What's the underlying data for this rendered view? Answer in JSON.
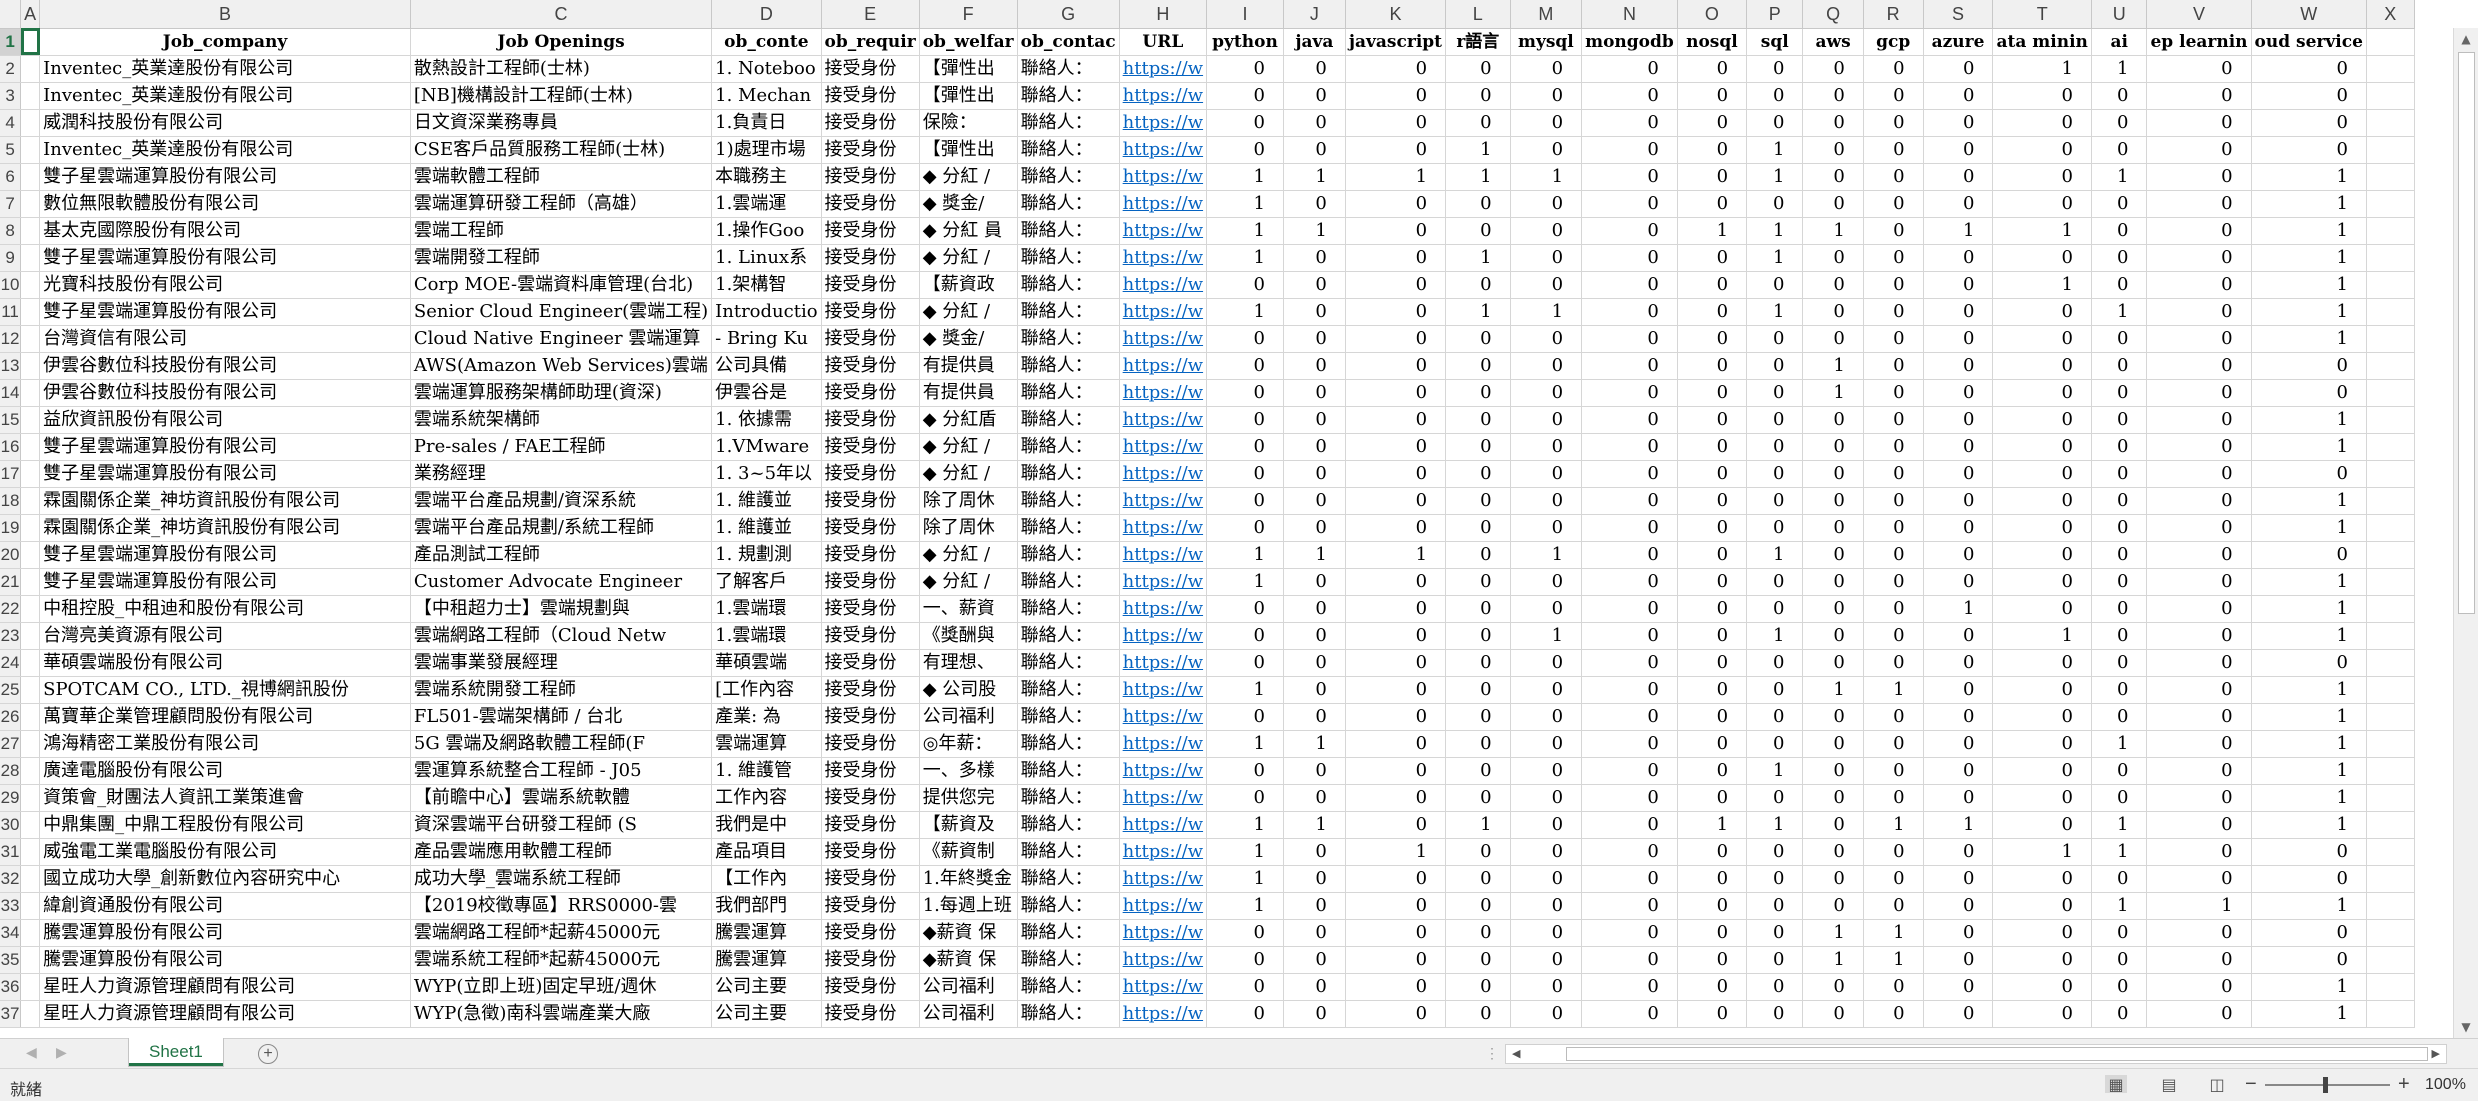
{
  "columns": [
    "A",
    "B",
    "C",
    "D",
    "E",
    "F",
    "G",
    "H",
    "I",
    "J",
    "K",
    "L",
    "M",
    "N",
    "O",
    "P",
    "Q",
    "R",
    "S",
    "T",
    "U",
    "V",
    "W",
    "X"
  ],
  "header_row": [
    "",
    "Job_company",
    "Job Openings",
    "ob_conte",
    "ob_requir",
    "ob_welfar",
    "ob_contac",
    "URL",
    "python",
    "java",
    "javascript",
    "r語言",
    "mysql",
    "mongodb",
    "nosql",
    "sql",
    "aws",
    "gcp",
    "azure",
    "ata minin",
    "ai",
    "ep learnin",
    "oud service",
    ""
  ],
  "rows": [
    {
      "n": 2,
      "company": "Inventec_英業達股份有限公司",
      "job": "散熱設計工程師(士林)",
      "content": "1. Noteboo",
      "req": "接受身份",
      "welf": "【彈性出",
      "contact": "聯絡人：",
      "url": "https://w",
      "v": [
        0,
        0,
        0,
        0,
        0,
        0,
        0,
        0,
        0,
        0,
        0,
        1,
        1,
        0,
        0
      ]
    },
    {
      "n": 3,
      "company": "Inventec_英業達股份有限公司",
      "job": "[NB]機構設計工程師(士林)",
      "content": "1. Mechan",
      "req": "接受身份",
      "welf": "【彈性出",
      "contact": "聯絡人：",
      "url": "https://w",
      "v": [
        0,
        0,
        0,
        0,
        0,
        0,
        0,
        0,
        0,
        0,
        0,
        0,
        0,
        0,
        0
      ]
    },
    {
      "n": 4,
      "company": "威潤科技股份有限公司",
      "job": "日文資深業務專員",
      "content": "1.負責日",
      "req": "接受身份",
      "welf": "保險：",
      "contact": "聯絡人：",
      "url": "https://w",
      "v": [
        0,
        0,
        0,
        0,
        0,
        0,
        0,
        0,
        0,
        0,
        0,
        0,
        0,
        0,
        0
      ]
    },
    {
      "n": 5,
      "company": "Inventec_英業達股份有限公司",
      "job": "CSE客戶品質服務工程師(士林)",
      "content": "1)處理市場",
      "req": "接受身份",
      "welf": "【彈性出",
      "contact": "聯絡人：",
      "url": "https://w",
      "v": [
        0,
        0,
        0,
        1,
        0,
        0,
        0,
        1,
        0,
        0,
        0,
        0,
        0,
        0,
        0
      ]
    },
    {
      "n": 6,
      "company": "雙子星雲端運算股份有限公司",
      "job": "雲端軟體工程師",
      "content": "本職務主",
      "req": "接受身份",
      "welf": "◆ 分紅 /",
      "contact": "聯絡人：",
      "url": "https://w",
      "v": [
        1,
        1,
        1,
        1,
        1,
        0,
        0,
        1,
        0,
        0,
        0,
        0,
        1,
        0,
        1
      ]
    },
    {
      "n": 7,
      "company": "數位無限軟體股份有限公司",
      "job": "雲端運算研發工程師（高雄）",
      "content": "1.雲端運",
      "req": "接受身份",
      "welf": "◆ 獎金/",
      "contact": "聯絡人：",
      "url": "https://w",
      "v": [
        1,
        0,
        0,
        0,
        0,
        0,
        0,
        0,
        0,
        0,
        0,
        0,
        0,
        0,
        1
      ]
    },
    {
      "n": 8,
      "company": "基太克國際股份有限公司",
      "job": "雲端工程師",
      "content": "1.操作Goo",
      "req": "接受身份",
      "welf": "◆ 分紅 員",
      "contact": "聯絡人：",
      "url": "https://w",
      "v": [
        1,
        1,
        0,
        0,
        0,
        0,
        1,
        1,
        1,
        0,
        1,
        1,
        0,
        0,
        1
      ]
    },
    {
      "n": 9,
      "company": "雙子星雲端運算股份有限公司",
      "job": "雲端開發工程師",
      "content": "1. Linux系",
      "req": "接受身份",
      "welf": "◆ 分紅 /",
      "contact": "聯絡人：",
      "url": "https://w",
      "v": [
        1,
        0,
        0,
        1,
        0,
        0,
        0,
        1,
        0,
        0,
        0,
        0,
        0,
        0,
        1
      ]
    },
    {
      "n": 10,
      "company": "光寶科技股份有限公司",
      "job": "Corp MOE-雲端資料庫管理(台北)",
      "content": "1.架構智",
      "req": "接受身份",
      "welf": "【薪資政",
      "contact": "聯絡人：",
      "url": "https://w",
      "v": [
        0,
        0,
        0,
        0,
        0,
        0,
        0,
        0,
        0,
        0,
        0,
        1,
        0,
        0,
        1
      ]
    },
    {
      "n": 11,
      "company": "雙子星雲端運算股份有限公司",
      "job": "Senior Cloud Engineer(雲端工程)",
      "content": "Introductio",
      "req": "接受身份",
      "welf": "◆ 分紅 /",
      "contact": "聯絡人：",
      "url": "https://w",
      "v": [
        1,
        0,
        0,
        1,
        1,
        0,
        0,
        1,
        0,
        0,
        0,
        0,
        1,
        0,
        1
      ]
    },
    {
      "n": 12,
      "company": "台灣資信有限公司",
      "job": "Cloud Native Engineer 雲端運算",
      "content": "- Bring Ku",
      "req": "接受身份",
      "welf": "◆ 獎金/",
      "contact": "聯絡人：",
      "url": "https://w",
      "v": [
        0,
        0,
        0,
        0,
        0,
        0,
        0,
        0,
        0,
        0,
        0,
        0,
        0,
        0,
        1
      ]
    },
    {
      "n": 13,
      "company": "伊雲谷數位科技股份有限公司",
      "job": "AWS(Amazon Web Services)雲端",
      "content": "公司具備",
      "req": "接受身份",
      "welf": "有提供員",
      "contact": "聯絡人：",
      "url": "https://w",
      "v": [
        0,
        0,
        0,
        0,
        0,
        0,
        0,
        0,
        1,
        0,
        0,
        0,
        0,
        0,
        0
      ]
    },
    {
      "n": 14,
      "company": "伊雲谷數位科技股份有限公司",
      "job": "雲端運算服務架構師助理(資深)",
      "content": "伊雲谷是",
      "req": "接受身份",
      "welf": "有提供員",
      "contact": "聯絡人：",
      "url": "https://w",
      "v": [
        0,
        0,
        0,
        0,
        0,
        0,
        0,
        0,
        1,
        0,
        0,
        0,
        0,
        0,
        0
      ]
    },
    {
      "n": 15,
      "company": "益欣資訊股份有限公司",
      "job": "雲端系統架構師",
      "content": "1. 依據需",
      "req": "接受身份",
      "welf": "◆ 分紅盾",
      "contact": "聯絡人：",
      "url": "https://w",
      "v": [
        0,
        0,
        0,
        0,
        0,
        0,
        0,
        0,
        0,
        0,
        0,
        0,
        0,
        0,
        1
      ]
    },
    {
      "n": 16,
      "company": "雙子星雲端運算股份有限公司",
      "job": "Pre-sales / FAE工程師",
      "content": "1.VMware",
      "req": "接受身份",
      "welf": "◆ 分紅 /",
      "contact": "聯絡人：",
      "url": "https://w",
      "v": [
        0,
        0,
        0,
        0,
        0,
        0,
        0,
        0,
        0,
        0,
        0,
        0,
        0,
        0,
        1
      ]
    },
    {
      "n": 17,
      "company": "雙子星雲端運算股份有限公司",
      "job": "業務經理",
      "content": "1. 3~5年以",
      "req": "接受身份",
      "welf": "◆ 分紅 /",
      "contact": "聯絡人：",
      "url": "https://w",
      "v": [
        0,
        0,
        0,
        0,
        0,
        0,
        0,
        0,
        0,
        0,
        0,
        0,
        0,
        0,
        0
      ]
    },
    {
      "n": 18,
      "company": "霖園關係企業_神坊資訊股份有限公司",
      "job": "雲端平台產品規劃/資深系統",
      "content": "1. 維護並",
      "req": "接受身份",
      "welf": "除了周休",
      "contact": "聯絡人：",
      "url": "https://w",
      "v": [
        0,
        0,
        0,
        0,
        0,
        0,
        0,
        0,
        0,
        0,
        0,
        0,
        0,
        0,
        1
      ]
    },
    {
      "n": 19,
      "company": "霖園關係企業_神坊資訊股份有限公司",
      "job": "雲端平台產品規劃/系統工程師",
      "content": "1. 維護並",
      "req": "接受身份",
      "welf": "除了周休",
      "contact": "聯絡人：",
      "url": "https://w",
      "v": [
        0,
        0,
        0,
        0,
        0,
        0,
        0,
        0,
        0,
        0,
        0,
        0,
        0,
        0,
        1
      ]
    },
    {
      "n": 20,
      "company": "雙子星雲端運算股份有限公司",
      "job": "產品測試工程師",
      "content": "1. 規劃測",
      "req": "接受身份",
      "welf": "◆ 分紅 /",
      "contact": "聯絡人：",
      "url": "https://w",
      "v": [
        1,
        1,
        1,
        0,
        1,
        0,
        0,
        1,
        0,
        0,
        0,
        0,
        0,
        0,
        0
      ]
    },
    {
      "n": 21,
      "company": "雙子星雲端運算股份有限公司",
      "job": "Customer Advocate Engineer",
      "content": "了解客戶",
      "req": "接受身份",
      "welf": "◆ 分紅 /",
      "contact": "聯絡人：",
      "url": "https://w",
      "v": [
        1,
        0,
        0,
        0,
        0,
        0,
        0,
        0,
        0,
        0,
        0,
        0,
        0,
        0,
        1
      ]
    },
    {
      "n": 22,
      "company": "中租控股_中租迪和股份有限公司",
      "job": "【中租超力士】雲端規劃與",
      "content": "1.雲端環",
      "req": "接受身份",
      "welf": "一、薪資",
      "contact": "聯絡人：",
      "url": "https://w",
      "v": [
        0,
        0,
        0,
        0,
        0,
        0,
        0,
        0,
        0,
        0,
        1,
        0,
        0,
        0,
        1
      ]
    },
    {
      "n": 23,
      "company": "台灣亮美資源有限公司",
      "job": "雲端網路工程師（Cloud Netw",
      "content": "1.雲端環",
      "req": "接受身份",
      "welf": "《獎酬與",
      "contact": "聯絡人：",
      "url": "https://w",
      "v": [
        0,
        0,
        0,
        0,
        1,
        0,
        0,
        1,
        0,
        0,
        0,
        1,
        0,
        0,
        1
      ]
    },
    {
      "n": 24,
      "company": "華碩雲端股份有限公司",
      "job": "雲端事業發展經理",
      "content": "華碩雲端",
      "req": "接受身份",
      "welf": "有理想、",
      "contact": "聯絡人：",
      "url": "https://w",
      "v": [
        0,
        0,
        0,
        0,
        0,
        0,
        0,
        0,
        0,
        0,
        0,
        0,
        0,
        0,
        0
      ]
    },
    {
      "n": 25,
      "company": "SPOTCAM CO., LTD._視博網訊股份",
      "job": "雲端系統開發工程師",
      "content": "[工作內容",
      "req": "接受身份",
      "welf": "◆ 公司股",
      "contact": "聯絡人：",
      "url": "https://w",
      "v": [
        1,
        0,
        0,
        0,
        0,
        0,
        0,
        0,
        1,
        1,
        0,
        0,
        0,
        0,
        1
      ]
    },
    {
      "n": 26,
      "company": "萬寶華企業管理顧問股份有限公司",
      "job": "FL501-雲端架構師 / 台北",
      "content": "產業: 為",
      "req": "接受身份",
      "welf": "公司福利",
      "contact": "聯絡人：",
      "url": "https://w",
      "v": [
        0,
        0,
        0,
        0,
        0,
        0,
        0,
        0,
        0,
        0,
        0,
        0,
        0,
        0,
        1
      ]
    },
    {
      "n": 27,
      "company": "鴻海精密工業股份有限公司",
      "job": "5G 雲端及網路軟體工程師(F",
      "content": "雲端運算",
      "req": "接受身份",
      "welf": "◎年薪：",
      "contact": "聯絡人：",
      "url": "https://w",
      "v": [
        1,
        1,
        0,
        0,
        0,
        0,
        0,
        0,
        0,
        0,
        0,
        0,
        1,
        0,
        1
      ]
    },
    {
      "n": 28,
      "company": "廣達電腦股份有限公司",
      "job": "雲運算系統整合工程師 - J05",
      "content": "1. 維護管",
      "req": "接受身份",
      "welf": "一、多樣",
      "contact": "聯絡人：",
      "url": "https://w",
      "v": [
        0,
        0,
        0,
        0,
        0,
        0,
        0,
        1,
        0,
        0,
        0,
        0,
        0,
        0,
        1
      ]
    },
    {
      "n": 29,
      "company": "資策會_財團法人資訊工業策進會",
      "job": "【前瞻中心】雲端系統軟體",
      "content": "工作內容",
      "req": "接受身份",
      "welf": "提供您完",
      "contact": "聯絡人：",
      "url": "https://w",
      "v": [
        0,
        0,
        0,
        0,
        0,
        0,
        0,
        0,
        0,
        0,
        0,
        0,
        0,
        0,
        1
      ]
    },
    {
      "n": 30,
      "company": "中鼎集團_中鼎工程股份有限公司",
      "job": "資深雲端平台研發工程師 (S",
      "content": "我們是中",
      "req": "接受身份",
      "welf": "【薪資及",
      "contact": "聯絡人：",
      "url": "https://w",
      "v": [
        1,
        1,
        0,
        1,
        0,
        0,
        1,
        1,
        0,
        1,
        1,
        0,
        1,
        0,
        1
      ]
    },
    {
      "n": 31,
      "company": "威強電工業電腦股份有限公司",
      "job": "產品雲端應用軟體工程師",
      "content": "產品項目",
      "req": "接受身份",
      "welf": "《薪資制",
      "contact": "聯絡人：",
      "url": "https://w",
      "v": [
        1,
        0,
        1,
        0,
        0,
        0,
        0,
        0,
        0,
        0,
        0,
        1,
        1,
        0,
        0
      ]
    },
    {
      "n": 32,
      "company": "國立成功大學_創新數位內容研究中心",
      "job": "成功大學_雲端系統工程師",
      "content": "【工作內",
      "req": "接受身份",
      "welf": "1.年終獎金",
      "contact": "聯絡人：",
      "url": "https://w",
      "v": [
        1,
        0,
        0,
        0,
        0,
        0,
        0,
        0,
        0,
        0,
        0,
        0,
        0,
        0,
        0
      ]
    },
    {
      "n": 33,
      "company": "緯創資通股份有限公司",
      "job": "【2019校徵專區】RRS0000-雲",
      "content": "我們部門",
      "req": "接受身份",
      "welf": "1.每週上班",
      "contact": "聯絡人：",
      "url": "https://w",
      "v": [
        1,
        0,
        0,
        0,
        0,
        0,
        0,
        0,
        0,
        0,
        0,
        0,
        1,
        1,
        1
      ]
    },
    {
      "n": 34,
      "company": "騰雲運算股份有限公司",
      "job": "雲端網路工程師*起薪45000元",
      "content": "騰雲運算",
      "req": "接受身份",
      "welf": "◆薪資 保",
      "contact": "聯絡人：",
      "url": "https://w",
      "v": [
        0,
        0,
        0,
        0,
        0,
        0,
        0,
        0,
        1,
        1,
        0,
        0,
        0,
        0,
        0
      ]
    },
    {
      "n": 35,
      "company": "騰雲運算股份有限公司",
      "job": "雲端系統工程師*起薪45000元",
      "content": "騰雲運算",
      "req": "接受身份",
      "welf": "◆薪資 保",
      "contact": "聯絡人：",
      "url": "https://w",
      "v": [
        0,
        0,
        0,
        0,
        0,
        0,
        0,
        0,
        1,
        1,
        0,
        0,
        0,
        0,
        0
      ]
    },
    {
      "n": 36,
      "company": "星旺人力資源管理顧問有限公司",
      "job": "WYP(立即上班)固定早班/週休",
      "content": "公司主要",
      "req": "接受身份",
      "welf": "公司福利",
      "contact": "聯絡人：",
      "url": "https://w",
      "v": [
        0,
        0,
        0,
        0,
        0,
        0,
        0,
        0,
        0,
        0,
        0,
        0,
        0,
        0,
        1
      ]
    },
    {
      "n": 37,
      "company": "星旺人力資源管理顧問有限公司",
      "job": "WYP(急徵)南科雲端產業大廠",
      "content": "公司主要",
      "req": "接受身份",
      "welf": "公司福利",
      "contact": "聯絡人：",
      "url": "https://w",
      "v": [
        0,
        0,
        0,
        0,
        0,
        0,
        0,
        0,
        0,
        0,
        0,
        0,
        0,
        0,
        1
      ]
    }
  ],
  "sheet_tab": "Sheet1",
  "status_text": "就緒",
  "zoom_level": "100%",
  "zoom_fraction": 0.46
}
